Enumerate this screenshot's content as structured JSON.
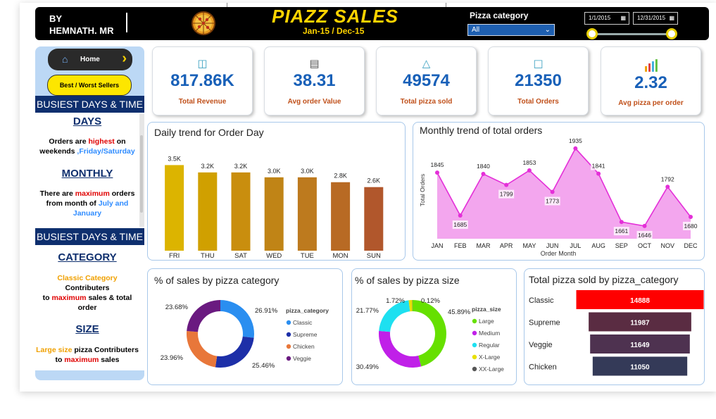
{
  "header": {
    "author_line1": "BY",
    "author_line2": "HEMNATH. MR",
    "title": "PIAZZ SALES",
    "subtitle": "Jan-15 / Dec-15",
    "filter_label": "Pizza category",
    "filter_value": "All",
    "date_start": "1/1/2015",
    "date_end": "12/31/2015",
    "logo_icon": "pizza-icon"
  },
  "sidebar": {
    "home_label": "Home",
    "best_worst_label": "Best / Worst Sellers",
    "band1": "BUSIEST DAYS & TIME",
    "band2": "BUSIEST DAYS & TIME",
    "days_head": "DAYS",
    "days_text": {
      "p1": "Orders are ",
      "p2": "highest",
      "p3": " on weekends ",
      "p4": ",Friday/Saturday"
    },
    "monthly_head": "MONTHLY",
    "monthly_text": {
      "p1": "There are ",
      "p2": "maximum",
      "p3": " orders from month of ",
      "p4": "July and January"
    },
    "category_head": "CATEGORY",
    "category_text": {
      "p1": "Classic Category",
      "p2": "Contributers",
      "p3": "to ",
      "p4": "maximum",
      "p5": " sales & total order"
    },
    "size_head": "SIZE",
    "size_text": {
      "p1": "Large size",
      "p2": " pizza Contributers to ",
      "p3": "maximum",
      "p4": " sales"
    }
  },
  "kpis": [
    {
      "value": "817.86K",
      "label": "Total Revenue",
      "icon": "money-icon"
    },
    {
      "value": "38.31",
      "label": "Avg order Value",
      "icon": "receipt-icon"
    },
    {
      "value": "49574",
      "label": "Total pizza sold",
      "icon": "pizza-slice-icon"
    },
    {
      "value": "21350",
      "label": "Total Orders",
      "icon": "order-icon"
    },
    {
      "value": "2.32",
      "label": "Avg pizza per order",
      "icon": "bar-chart-icon"
    }
  ],
  "colors": {
    "accent_blue": "#1860b8",
    "kpi_label": "#c0501a",
    "title_yellow": "#ffd400",
    "navy": "#0e2f6e"
  },
  "chart_data": [
    {
      "type": "bar",
      "title": "Daily trend for Order Day",
      "categories": [
        "FRI",
        "THU",
        "SAT",
        "WED",
        "TUE",
        "MON",
        "SUN"
      ],
      "values": [
        3.5,
        3.2,
        3.2,
        3.0,
        3.0,
        2.8,
        2.6
      ],
      "labels": [
        "3.5K",
        "3.2K",
        "3.2K",
        "3.0K",
        "3.0K",
        "2.8K",
        "2.6K"
      ],
      "colors": [
        "#dcb400",
        "#d0a000",
        "#c98e0e",
        "#c08416",
        "#bd7a1e",
        "#b86a24",
        "#b1572c"
      ],
      "ylim": [
        0,
        3.8
      ]
    },
    {
      "type": "area",
      "title": "Monthly trend of total orders",
      "categories": [
        "JAN",
        "FEB",
        "MAR",
        "APR",
        "MAY",
        "JUN",
        "JUL",
        "AUG",
        "SEP",
        "OCT",
        "NOV",
        "DEC"
      ],
      "values": [
        1845,
        1685,
        1840,
        1799,
        1853,
        1773,
        1935,
        1841,
        1661,
        1646,
        1792,
        1680
      ],
      "xlabel": "Order Month",
      "ylabel": "Total Orders",
      "ylim": [
        1630,
        1945
      ]
    },
    {
      "type": "pie",
      "title": "% of sales by pizza category",
      "legend_title": "pizza_category",
      "slices": [
        {
          "label": "Classic",
          "value": 26.91,
          "text": "26.91%",
          "color": "#2a8ef0"
        },
        {
          "label": "Supreme",
          "value": 25.46,
          "text": "25.46%",
          "color": "#1d2fa8"
        },
        {
          "label": "Chicken",
          "value": 23.96,
          "text": "23.96%",
          "color": "#e8773a"
        },
        {
          "label": "Veggie",
          "value": 23.68,
          "text": "23.68%",
          "color": "#6a1a80"
        }
      ]
    },
    {
      "type": "pie",
      "title": "% of sales by pizza size",
      "legend_title": "pizza_size",
      "slices": [
        {
          "label": "Large",
          "value": 45.89,
          "text": "45.89%",
          "color": "#66e000"
        },
        {
          "label": "Medium",
          "value": 30.49,
          "text": "30.49%",
          "color": "#c020e8"
        },
        {
          "label": "Regular",
          "value": 21.77,
          "text": "21.77%",
          "color": "#1ee0f0"
        },
        {
          "label": "X-Large",
          "value": 1.72,
          "text": "1.72%",
          "color": "#e8e000"
        },
        {
          "label": "XX-Large",
          "value": 0.12,
          "text": "0.12%",
          "color": "#555555"
        }
      ]
    },
    {
      "type": "bar",
      "title": "Total pizza sold by pizza_category",
      "categories": [
        "Classic",
        "Supreme",
        "Veggie",
        "Chicken"
      ],
      "values": [
        14888,
        11987,
        11649,
        11050
      ],
      "colors": [
        "#ff0000",
        "#5a2c42",
        "#4e3250",
        "#343a58"
      ]
    }
  ]
}
